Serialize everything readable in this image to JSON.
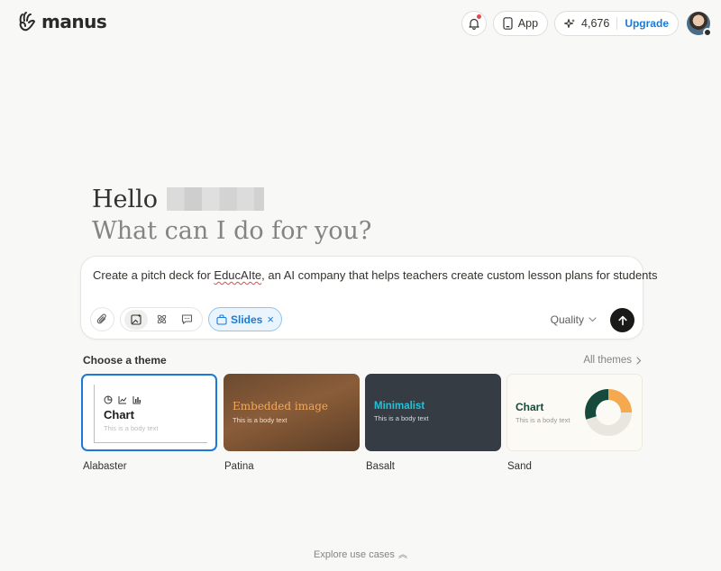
{
  "brand": {
    "name": "manus"
  },
  "header": {
    "app_label": "App",
    "credits": "4,676",
    "upgrade_label": "Upgrade",
    "notification_dot_color": "#e5484d"
  },
  "greeting": {
    "hello": "Hello",
    "subtitle": "What can I do for you?"
  },
  "composer": {
    "prompt_before": "Create a pitch deck for ",
    "prompt_misspelled": "EducAIte",
    "prompt_after": ", an AI company that helps teachers create custom lesson plans for students",
    "mode_chip": "Slides",
    "mode_chip_remove": "×",
    "quality_label": "Quality"
  },
  "themes": {
    "title": "Choose a theme",
    "all_label": "All themes",
    "selected": "Alabaster",
    "items": [
      {
        "name": "Alabaster",
        "title": "Chart",
        "body": "This is a body text"
      },
      {
        "name": "Patina",
        "title": "Embedded image",
        "body": "This is a body text"
      },
      {
        "name": "Basalt",
        "title": "Minimalist",
        "body": "This is a body text"
      },
      {
        "name": "Sand",
        "title": "Chart",
        "body": "This is a body text"
      }
    ]
  },
  "footer": {
    "explore_label": "Explore use cases"
  },
  "colors": {
    "accent": "#1a7ad9",
    "background": "#f8f8f7"
  }
}
